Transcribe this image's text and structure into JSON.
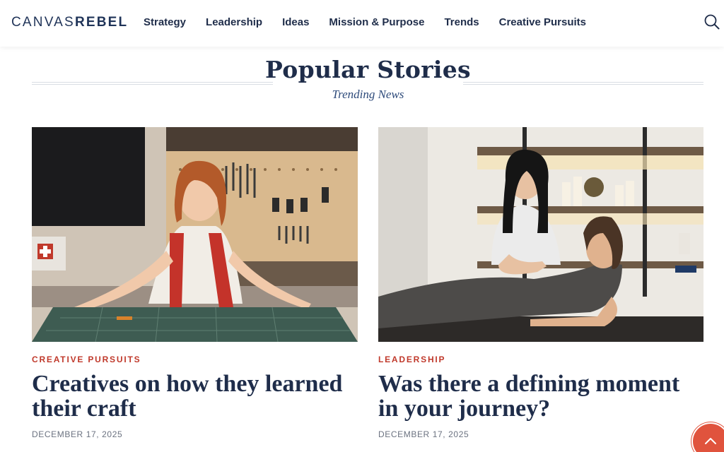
{
  "logo": {
    "part1": "CANVAS",
    "part2": "REBEL"
  },
  "nav": [
    "Strategy",
    "Leadership",
    "Ideas",
    "Mission & Purpose",
    "Trends",
    "Creative Pursuits"
  ],
  "section": {
    "title": "Popular Stories",
    "subtitle": "Trending News"
  },
  "cards": [
    {
      "category": "CREATIVE PURSUITS",
      "title": "Creatives on how they learned their craft",
      "date": "DECEMBER 17, 2025",
      "image": "woman-in-workshop-photo"
    },
    {
      "category": "LEADERSHIP",
      "title": "Was there a defining moment in your journey?",
      "date": "DECEMBER 17, 2025",
      "image": "massage-therapy-photo"
    }
  ],
  "icons": {
    "search": "search-icon",
    "back_to_top": "chevron-up-icon"
  },
  "colors": {
    "navy": "#1f2d4a",
    "accent_red": "#c0392b",
    "button_coral": "#e0533d"
  }
}
